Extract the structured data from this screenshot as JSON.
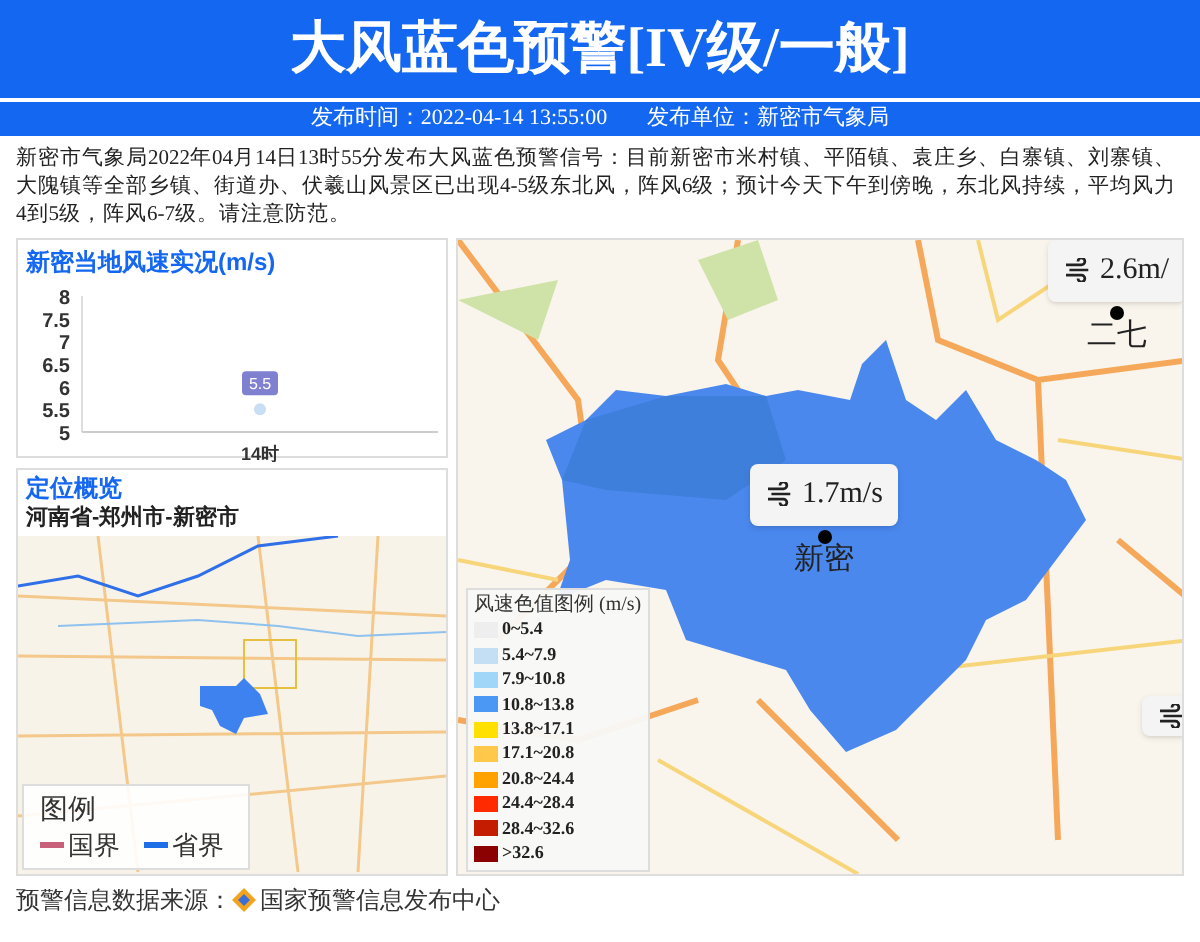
{
  "header": {
    "title": "大风蓝色预警[IV级/一般]",
    "publish_time": "发布时间：2022-04-14 13:55:00",
    "publisher": "发布单位：新密市气象局"
  },
  "description": "新密市气象局2022年04月14日13时55分发布大风蓝色预警信号：目前新密市米村镇、平陌镇、袁庄乡、白寨镇、刘寨镇、大隗镇等全部乡镇、街道办、伏羲山风景区已出现4-5级东北风，阵风6级；预计今天下午到傍晚，东北风持续，平均风力4到5级，阵风6-7级。请注意防范。",
  "wind_panel": {
    "title": "新密当地风速实况(m/s)",
    "chart_data": {
      "type": "line",
      "categories": [
        "14时"
      ],
      "series": [
        {
          "color": "#c8def4",
          "marker": "circle",
          "values": [
            5.5
          ]
        }
      ],
      "ylim": [
        5,
        8
      ],
      "yticks": [
        5,
        5.5,
        6,
        6.5,
        7,
        7.5,
        8
      ],
      "data_labels": true
    }
  },
  "location_panel": {
    "title": "定位概览",
    "path": "河南省-郑州市-新密市",
    "legend_title": "图例",
    "legend": [
      {
        "label": "国界",
        "color": "#c8607a"
      },
      {
        "label": "省界",
        "color": "#1e6ee8"
      }
    ]
  },
  "map": {
    "wind_labels": [
      {
        "speed": "2.6m/",
        "place": "二七"
      },
      {
        "speed": "1.7m/s",
        "place": "新密"
      }
    ],
    "legend_title": "风速色值图例 (m/s)",
    "legend": [
      {
        "label": "0~5.4",
        "color": "#eeeeee"
      },
      {
        "label": "5.4~7.9",
        "color": "#c4def4"
      },
      {
        "label": "7.9~10.8",
        "color": "#a0d6f8"
      },
      {
        "label": "10.8~13.8",
        "color": "#4a98f4"
      },
      {
        "label": "13.8~17.1",
        "color": "#ffe000"
      },
      {
        "label": "17.1~20.8",
        "color": "#ffc84a"
      },
      {
        "label": "20.8~24.4",
        "color": "#ffa200"
      },
      {
        "label": "24.4~28.4",
        "color": "#ff2a00"
      },
      {
        "label": "28.4~32.6",
        "color": "#c41c00"
      },
      {
        "label": ">32.6",
        "color": "#8b0000"
      }
    ]
  },
  "sources": [
    {
      "label": "预警信息数据来源：",
      "value": "国家预警信息发布中心"
    }
  ]
}
